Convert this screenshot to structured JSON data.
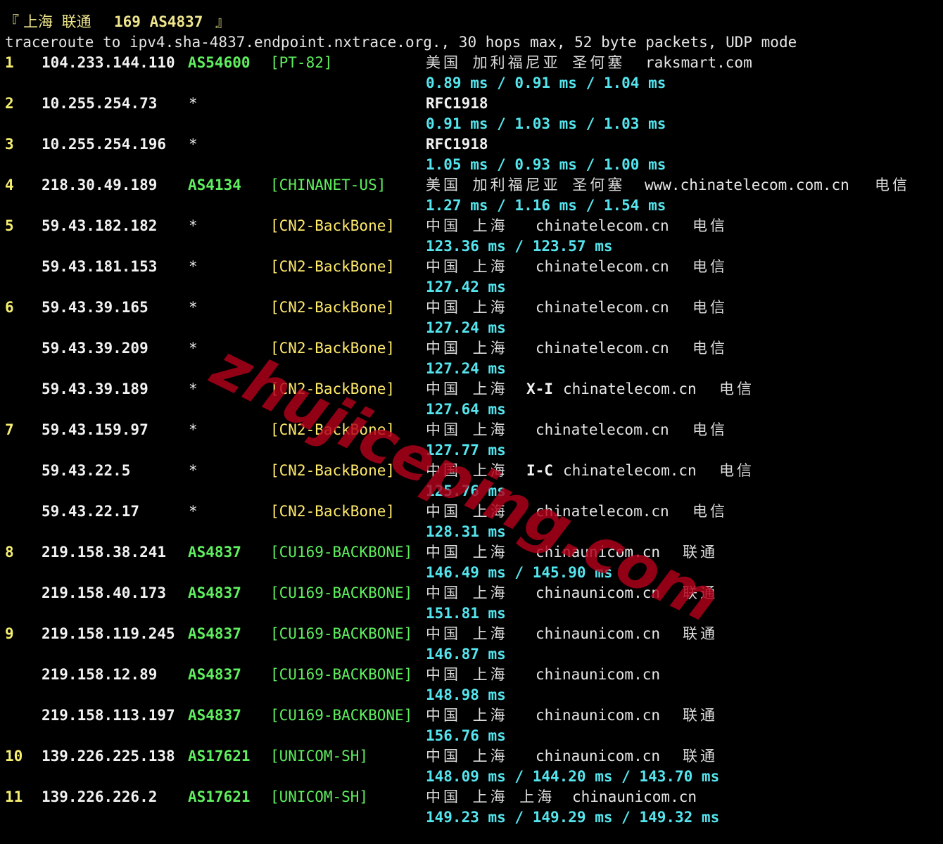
{
  "header": {
    "left_bracket": "『",
    "title_cn": "上海 联通",
    "title_code": "169 AS4837",
    "right_bracket": "』",
    "command": "traceroute to ipv4.sha-4837.endpoint.nxtrace.org., 30 hops max, 52 byte packets, UDP mode"
  },
  "hops": [
    {
      "hop": "1",
      "entries": [
        {
          "ip": "104.233.144.110",
          "asn": "AS54600",
          "tag": "[PT-82]",
          "geo": "美国 加利福尼亚 圣何塞",
          "extra": "",
          "domain": "raksmart.com",
          "isp": "",
          "rtt": "0.89 ms / 0.91 ms / 1.04 ms"
        }
      ]
    },
    {
      "hop": "2",
      "entries": [
        {
          "ip": "10.255.254.73",
          "asn": "*",
          "tag": "",
          "geo": "RFC1918",
          "extra": "",
          "domain": "",
          "isp": "",
          "rtt": "0.91 ms / 1.03 ms / 1.03 ms"
        }
      ]
    },
    {
      "hop": "3",
      "entries": [
        {
          "ip": "10.255.254.196",
          "asn": "*",
          "tag": "",
          "geo": "RFC1918",
          "extra": "",
          "domain": "",
          "isp": "",
          "rtt": "1.05 ms / 0.93 ms / 1.00 ms"
        }
      ]
    },
    {
      "hop": "4",
      "entries": [
        {
          "ip": "218.30.49.189",
          "asn": "AS4134",
          "tag": "[CHINANET-US]",
          "geo": "美国 加利福尼亚 圣何塞",
          "extra": "",
          "domain": "www.chinatelecom.com.cn",
          "isp": "电信",
          "rtt": "1.27 ms / 1.16 ms / 1.54 ms"
        }
      ]
    },
    {
      "hop": "5",
      "entries": [
        {
          "ip": "59.43.182.182",
          "asn": "*",
          "tag": "[CN2-BackBone]",
          "geo": "中国 上海",
          "extra": "",
          "domain": "chinatelecom.cn",
          "isp": "电信",
          "rtt": "123.36 ms / 123.57 ms"
        },
        {
          "ip": "59.43.181.153",
          "asn": "*",
          "tag": "[CN2-BackBone]",
          "geo": "中国 上海",
          "extra": "",
          "domain": "chinatelecom.cn",
          "isp": "电信",
          "rtt": "127.42 ms"
        }
      ]
    },
    {
      "hop": "6",
      "entries": [
        {
          "ip": "59.43.39.165",
          "asn": "*",
          "tag": "[CN2-BackBone]",
          "geo": "中国 上海",
          "extra": "",
          "domain": "chinatelecom.cn",
          "isp": "电信",
          "rtt": "127.24 ms"
        },
        {
          "ip": "59.43.39.209",
          "asn": "*",
          "tag": "[CN2-BackBone]",
          "geo": "中国 上海",
          "extra": "",
          "domain": "chinatelecom.cn",
          "isp": "电信",
          "rtt": "127.24 ms"
        },
        {
          "ip": "59.43.39.189",
          "asn": "*",
          "tag": "[CN2-BackBone]",
          "geo": "中国 上海",
          "extra": "X-I",
          "domain": "chinatelecom.cn",
          "isp": "电信",
          "rtt": "127.64 ms"
        }
      ]
    },
    {
      "hop": "7",
      "entries": [
        {
          "ip": "59.43.159.97",
          "asn": "*",
          "tag": "[CN2-BackBone]",
          "geo": "中国 上海",
          "extra": "",
          "domain": "chinatelecom.cn",
          "isp": "电信",
          "rtt": "127.77 ms"
        },
        {
          "ip": "59.43.22.5",
          "asn": "*",
          "tag": "[CN2-BackBone]",
          "geo": "中国 上海",
          "extra": "I-C",
          "domain": "chinatelecom.cn",
          "isp": "电信",
          "rtt": "125.76 ms"
        },
        {
          "ip": "59.43.22.17",
          "asn": "*",
          "tag": "[CN2-BackBone]",
          "geo": "中国 上海",
          "extra": "",
          "domain": "chinatelecom.cn",
          "isp": "电信",
          "rtt": "128.31 ms"
        }
      ]
    },
    {
      "hop": "8",
      "entries": [
        {
          "ip": "219.158.38.241",
          "asn": "AS4837",
          "tag": "[CU169-BACKBONE]",
          "geo": "中国 上海",
          "extra": "",
          "domain": "chinaunicom.cn",
          "isp": "联通",
          "rtt": "146.49 ms / 145.90 ms"
        },
        {
          "ip": "219.158.40.173",
          "asn": "AS4837",
          "tag": "[CU169-BACKBONE]",
          "geo": "中国 上海",
          "extra": "",
          "domain": "chinaunicom.cn",
          "isp": "联通",
          "rtt": "151.81 ms"
        }
      ]
    },
    {
      "hop": "9",
      "entries": [
        {
          "ip": "219.158.119.245",
          "asn": "AS4837",
          "tag": "[CU169-BACKBONE]",
          "geo": "中国 上海",
          "extra": "",
          "domain": "chinaunicom.cn",
          "isp": "联通",
          "rtt": "146.87 ms"
        },
        {
          "ip": "219.158.12.89",
          "asn": "AS4837",
          "tag": "[CU169-BACKBONE]",
          "geo": "中国 上海",
          "extra": "",
          "domain": "chinaunicom.cn",
          "isp": "",
          "rtt": "148.98 ms"
        },
        {
          "ip": "219.158.113.197",
          "asn": "AS4837",
          "tag": "[CU169-BACKBONE]",
          "geo": "中国 上海",
          "extra": "",
          "domain": "chinaunicom.cn",
          "isp": "联通",
          "rtt": "156.76 ms"
        }
      ]
    },
    {
      "hop": "10",
      "entries": [
        {
          "ip": "139.226.225.138",
          "asn": "AS17621",
          "tag": "[UNICOM-SH]",
          "geo": "中国 上海",
          "extra": "",
          "domain": "chinaunicom.cn",
          "isp": "联通",
          "rtt": "148.09 ms / 144.20 ms / 143.70 ms"
        }
      ]
    },
    {
      "hop": "11",
      "entries": [
        {
          "ip": "139.226.226.2",
          "asn": "AS17621",
          "tag": "[UNICOM-SH]",
          "geo": "中国 上海 上海",
          "extra": "",
          "domain": "chinaunicom.cn",
          "isp": "",
          "rtt": "149.23 ms / 149.29 ms / 149.32 ms"
        }
      ]
    }
  ],
  "watermark": "zhujiceping.com"
}
